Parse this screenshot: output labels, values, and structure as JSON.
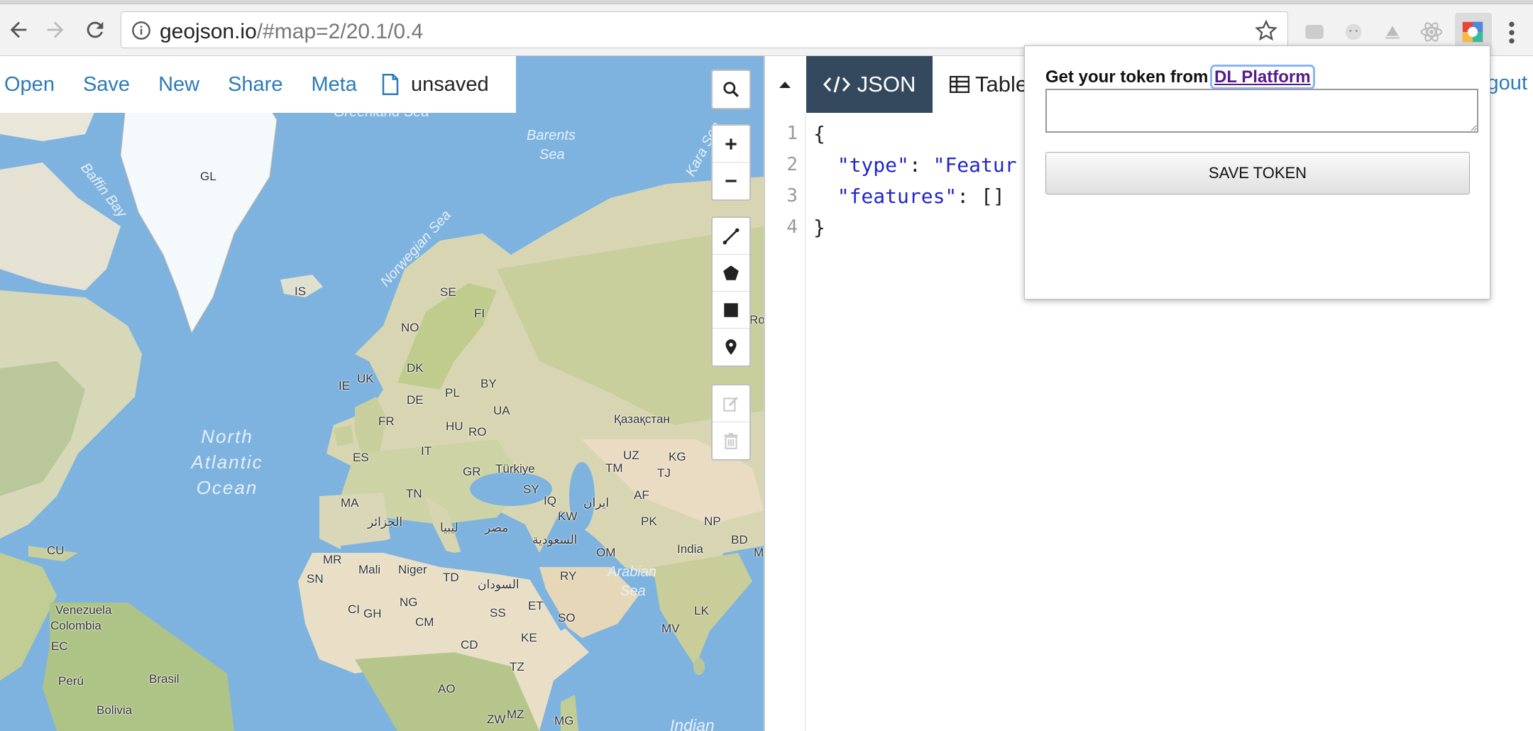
{
  "browser": {
    "url_host": "geojson.io",
    "url_rest": "/#map=2/20.1/0.4",
    "extensions": [
      "extension-1-icon",
      "extension-2-icon",
      "extension-3-icon",
      "react-devtools-icon",
      "dl-platform-extension-icon"
    ]
  },
  "menu": {
    "open": "Open",
    "save": "Save",
    "new": "New",
    "share": "Share",
    "meta": "Meta",
    "file_status": "unsaved"
  },
  "tabs": {
    "json": "JSON",
    "table": "Table",
    "logout": "Logout"
  },
  "editor": {
    "line_numbers": [
      "1",
      "2",
      "3",
      "4"
    ],
    "line1": "{",
    "line2_key": "\"type\"",
    "line2_colon": ": ",
    "line2_val": "\"Featur",
    "line3_key": "\"features\"",
    "line3_rest": ": []",
    "line4": "}"
  },
  "popup": {
    "prompt": "Get your token from",
    "link": "DL Platform",
    "textarea_value": "",
    "button": "SAVE TOKEN"
  },
  "map": {
    "country_labels": [
      {
        "id": "gl",
        "text": "GL"
      },
      {
        "id": "is",
        "text": "IS"
      },
      {
        "id": "se",
        "text": "SE"
      },
      {
        "id": "fi",
        "text": "FI"
      },
      {
        "id": "no",
        "text": "NO"
      },
      {
        "id": "dk",
        "text": "DK"
      },
      {
        "id": "ie",
        "text": "IE"
      },
      {
        "id": "uk",
        "text": "UK"
      },
      {
        "id": "by",
        "text": "BY"
      },
      {
        "id": "pl",
        "text": "PL"
      },
      {
        "id": "de",
        "text": "DE"
      },
      {
        "id": "ua",
        "text": "UA"
      },
      {
        "id": "fr",
        "text": "FR"
      },
      {
        "id": "hu",
        "text": "HU"
      },
      {
        "id": "ro",
        "text": "RO"
      },
      {
        "id": "kz",
        "text": "Қазақстан"
      },
      {
        "id": "es",
        "text": "ES"
      },
      {
        "id": "it",
        "text": "IT"
      },
      {
        "id": "uz",
        "text": "UZ"
      },
      {
        "id": "kg",
        "text": "KG"
      },
      {
        "id": "gr",
        "text": "GR"
      },
      {
        "id": "tr",
        "text": "Türkiye"
      },
      {
        "id": "tm",
        "text": "TM"
      },
      {
        "id": "tj",
        "text": "TJ"
      },
      {
        "id": "tn",
        "text": "TN"
      },
      {
        "id": "sy",
        "text": "SY"
      },
      {
        "id": "ma",
        "text": "MA"
      },
      {
        "id": "iq",
        "text": "IQ"
      },
      {
        "id": "ir",
        "text": "ایران"
      },
      {
        "id": "af",
        "text": "AF"
      },
      {
        "id": "dz",
        "text": "الجزائر"
      },
      {
        "id": "ly",
        "text": "ليبيا"
      },
      {
        "id": "eg",
        "text": "مصر"
      },
      {
        "id": "kw",
        "text": "KW"
      },
      {
        "id": "pk",
        "text": "PK"
      },
      {
        "id": "np",
        "text": "NP"
      },
      {
        "id": "sa",
        "text": "السعودية"
      },
      {
        "id": "bd",
        "text": "BD"
      },
      {
        "id": "om",
        "text": "OM"
      },
      {
        "id": "in",
        "text": "India"
      },
      {
        "id": "m",
        "text": "M"
      },
      {
        "id": "cu",
        "text": "CU"
      },
      {
        "id": "mr",
        "text": "MR"
      },
      {
        "id": "ml",
        "text": "Mali"
      },
      {
        "id": "ne",
        "text": "Niger"
      },
      {
        "id": "td",
        "text": "TD"
      },
      {
        "id": "ry",
        "text": "RY"
      },
      {
        "id": "sn",
        "text": "SN"
      },
      {
        "id": "sd",
        "text": "السودان"
      },
      {
        "id": "ng",
        "text": "NG"
      },
      {
        "id": "et",
        "text": "ET"
      },
      {
        "id": "ve",
        "text": "Venezuela"
      },
      {
        "id": "ci",
        "text": "CI"
      },
      {
        "id": "gh",
        "text": "GH"
      },
      {
        "id": "ss",
        "text": "SS"
      },
      {
        "id": "so",
        "text": "SO"
      },
      {
        "id": "lk",
        "text": "LK"
      },
      {
        "id": "co",
        "text": "Colombia"
      },
      {
        "id": "cm",
        "text": "CM"
      },
      {
        "id": "ec",
        "text": "EC"
      },
      {
        "id": "mv",
        "text": "MV"
      },
      {
        "id": "cd",
        "text": "CD"
      },
      {
        "id": "ke",
        "text": "KE"
      },
      {
        "id": "tz",
        "text": "TZ"
      },
      {
        "id": "br",
        "text": "Brasil"
      },
      {
        "id": "pe",
        "text": "Perú"
      },
      {
        "id": "ao",
        "text": "AO"
      },
      {
        "id": "bo",
        "text": "Bolivia"
      },
      {
        "id": "zw",
        "text": "ZW"
      },
      {
        "id": "mz",
        "text": "MZ"
      },
      {
        "id": "mg",
        "text": "MG"
      },
      {
        "id": "roc",
        "text": "Roc"
      }
    ],
    "sea_labels": {
      "greenland_sea": "Greenland Sea",
      "barents_sea_1": "Barents",
      "barents_sea_2": "Sea",
      "kara_sea": "Kara Sea",
      "baffin_bay": "Baffin Bay",
      "norwegian_sea": "Norwegian Sea",
      "arabian_sea_1": "Arabian",
      "arabian_sea_2": "Sea",
      "indian_ocean": "Indian"
    },
    "ocean_lines": [
      "North",
      "Atlantic",
      "Ocean"
    ]
  }
}
